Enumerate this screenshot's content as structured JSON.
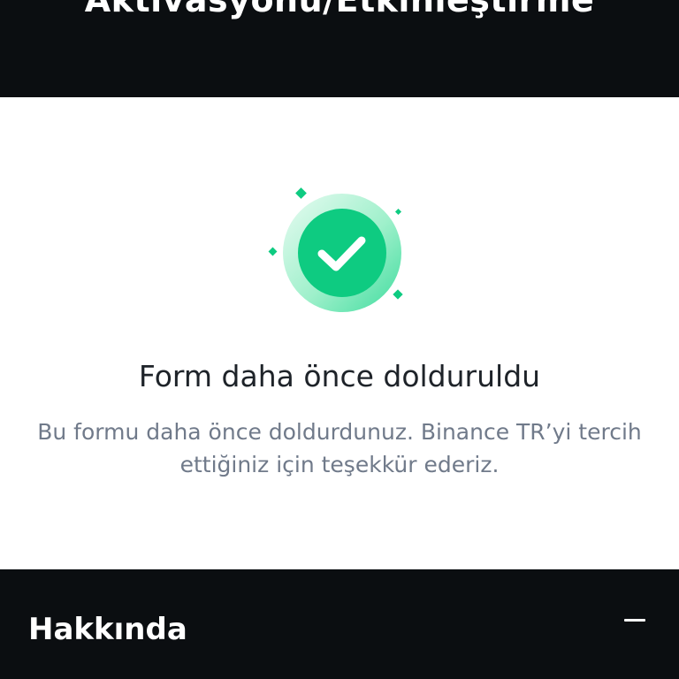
{
  "header": {
    "title": "Aktivasyonu/Etkinleştirme"
  },
  "status": {
    "icon": "check-circle-icon",
    "title": "Form daha önce dolduruldu",
    "description": "Bu formu daha önce doldurdunuz. Binance TR’yi tercih ettiğiniz için teşekkür ederiz.",
    "accent_color": "#0ecb81"
  },
  "accordion": {
    "label": "Hakkında",
    "toggle_icon": "minus-icon"
  }
}
